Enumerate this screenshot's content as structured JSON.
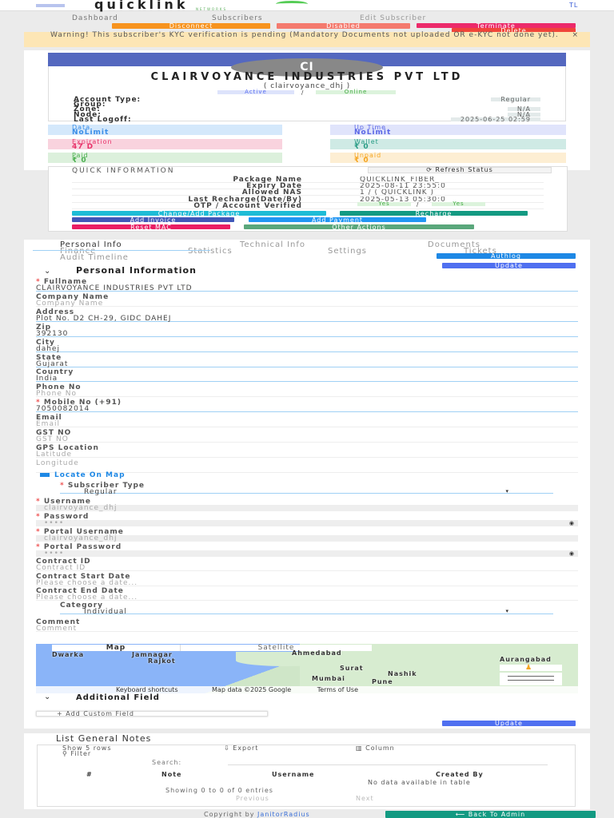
{
  "header": {
    "logo": "quicklink",
    "logo_sub": "NETWORKS",
    "user_initials": "TL"
  },
  "breadcrumb": [
    "Dashboard",
    "Subscribers",
    "Edit Subscriber"
  ],
  "actions": {
    "disconnect": "Disconnect",
    "disabled": "Disabled",
    "terminate": "Terminate",
    "delete": "Delete"
  },
  "warning": "Warning! This subscriber's KYC verification is pending (Mandatory Documents not uploaded OR e-KYC not done yet).",
  "profile": {
    "initials": "CI",
    "name": "CLAIRVOYANCE INDUSTRIES PVT LTD",
    "username": "( clairvoyance_dhj )",
    "status": "Active",
    "online": "Online",
    "sep": "/",
    "info": [
      {
        "k": "Account Type:",
        "v": "Regular"
      },
      {
        "k": "Group:",
        "v": ""
      },
      {
        "k": "Zone:",
        "v": "N/A"
      },
      {
        "k": "Node:",
        "v": "N/A"
      },
      {
        "k": "Last Logoff:",
        "v": "2025-06-25 02:59"
      }
    ]
  },
  "stats": [
    {
      "label": "Data",
      "value": "NoLimit"
    },
    {
      "label": "Up Time",
      "value": "NoLimit"
    },
    {
      "label": "Expiration",
      "value": "47 D"
    },
    {
      "label": "Wallet",
      "value": "₹ 0"
    },
    {
      "label": "Paid",
      "value": "₹ 0"
    },
    {
      "label": "Unpaid",
      "value": "₹ 0"
    }
  ],
  "quick": {
    "title": "QUICK INFORMATION",
    "refresh": "Refresh Status",
    "rows": [
      {
        "k": "Package Name",
        "v": "QUICKLINK_FIBER_"
      },
      {
        "k": "Expiry Date",
        "v": "2025-08-11 23:55:0"
      },
      {
        "k": "Allowed NAS",
        "v": "1 / ( QUICKLINK )"
      },
      {
        "k": "Last Recharge(Date/By)",
        "v": "2025-05-13 05:30:0"
      },
      {
        "k": "OTP / Account Verified",
        "v": ""
      }
    ],
    "otp": "Yes",
    "verified": "Yes",
    "buttons": {
      "change_package": "Change/Add Package",
      "recharge": "Recharge",
      "add_invoice": "Add Invoice",
      "add_payment": "Add Payment",
      "reset_mac": "Reset MAC",
      "other_actions": "Other Actions"
    }
  },
  "tabs": [
    "Personal Info",
    "Technical Info",
    "Documents",
    "Finance",
    "Statistics",
    "Settings",
    "Tickets",
    "Audit Timeline"
  ],
  "authlog": "Authlog",
  "update": "Update",
  "section_title": "Personal Information",
  "fields": [
    {
      "label": "Fullname",
      "value": "CLAIRVOYANCE INDUSTRIES PVT LTD",
      "req": true
    },
    {
      "label": "Company Name",
      "value": "Company Name",
      "ph": true
    },
    {
      "label": "Address",
      "value": "Plot No. D2 CH-29, GIDC DAHEJ"
    },
    {
      "label": "Zip",
      "value": "392130"
    },
    {
      "label": "City",
      "value": "dahej"
    },
    {
      "label": "State",
      "value": "Gujarat"
    },
    {
      "label": "Country",
      "value": "India"
    },
    {
      "label": "Phone No",
      "value": "Phone No",
      "ph": true
    },
    {
      "label": "Mobile No (+91)",
      "value": "7050082014",
      "req": true
    },
    {
      "label": "Email",
      "value": "Email",
      "ph": true
    },
    {
      "label": "GST NO",
      "value": "GST NO",
      "ph": true
    },
    {
      "label": "GPS Location",
      "value": "Latitude",
      "ph": true
    },
    {
      "label": "",
      "value": "Longitude",
      "ph": true
    }
  ],
  "locate_map": "Locate On Map",
  "subscriber_type": {
    "label": "Subscriber Type",
    "value": "Regular"
  },
  "account_fields": [
    {
      "label": "Username",
      "value": "clairvoyance_dhj"
    },
    {
      "label": "Password",
      "value": "••••",
      "eye": true
    },
    {
      "label": "Portal Username",
      "value": "clairvoyance_dhj"
    },
    {
      "label": "Portal Password",
      "value": "••••",
      "eye": true
    }
  ],
  "contract_fields": [
    {
      "label": "Contract ID",
      "value": "Contract ID"
    },
    {
      "label": "Contract Start Date",
      "value": "Please choose a date..."
    },
    {
      "label": "Contract End Date",
      "value": "Please choose a date..."
    }
  ],
  "category": {
    "label": "Category",
    "value": "Individual"
  },
  "comment": {
    "label": "Comment",
    "value": "Comment"
  },
  "map": {
    "tab_map": "Map",
    "tab_satellite": "Satellite",
    "places": [
      "Dwarka",
      "Jamnagar",
      "Rajkot",
      "Ahmedabad",
      "Surat",
      "Nashik",
      "Mumbai",
      "Pune",
      "Aurangabad"
    ],
    "footer": [
      "Keyboard shortcuts",
      "Map data ©2025 Google",
      "Terms of Use"
    ]
  },
  "additional_field": "Additional Field",
  "add_custom_field": "Add Custom Field",
  "notes": {
    "title": "List General Notes",
    "show_rows": "Show 5 rows",
    "export": "Export",
    "column": "Column",
    "filter": "Filter",
    "search_label": "Search:",
    "headers": [
      "#",
      "Note",
      "Username",
      "Created By"
    ],
    "empty": "No data available in table",
    "showing": "Showing 0 to 0 of 0 entries",
    "previous": "Previous",
    "next": "Next"
  },
  "footer": {
    "copyright": "Copyright by",
    "brand": "JanitorRadius",
    "back": "Back To Admin"
  }
}
